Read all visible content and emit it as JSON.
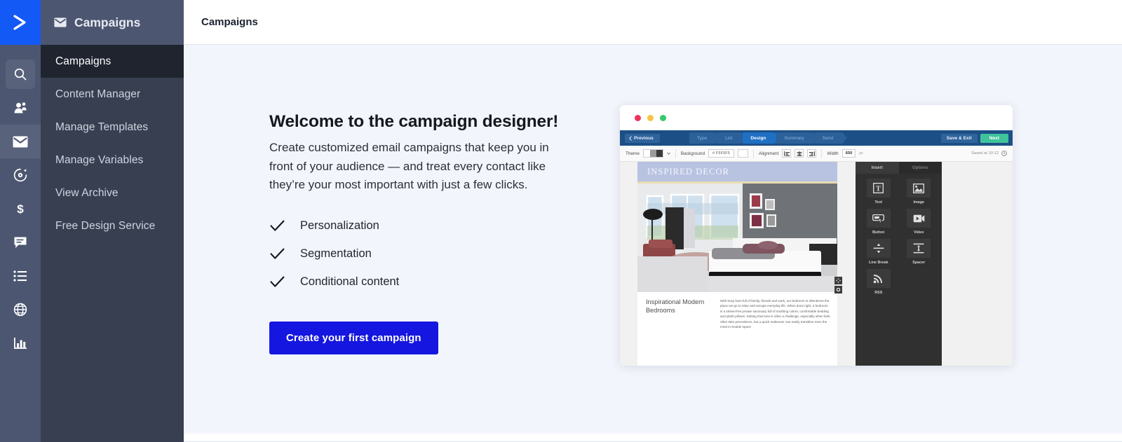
{
  "brand": {
    "logo_icon": "activecampaign-chevron-icon",
    "logo_color": "#1359f5"
  },
  "rail": {
    "items": [
      {
        "icon": "search-icon",
        "name": "search",
        "selected": true
      },
      {
        "icon": "contacts-people-icon",
        "name": "contacts",
        "selected": false
      },
      {
        "icon": "envelope-icon",
        "name": "campaigns",
        "selected": true
      },
      {
        "icon": "automations-gear-icon",
        "name": "automations",
        "selected": false
      },
      {
        "icon": "dollar-sign-icon",
        "name": "deals",
        "selected": false
      },
      {
        "icon": "chat-bubble-icon",
        "name": "conversations",
        "selected": false
      },
      {
        "icon": "list-icon",
        "name": "lists",
        "selected": false
      },
      {
        "icon": "globe-icon",
        "name": "website",
        "selected": false
      },
      {
        "icon": "bar-chart-icon",
        "name": "reports",
        "selected": false
      }
    ]
  },
  "subnav": {
    "header_icon": "envelope-icon",
    "header": "Campaigns",
    "items": [
      {
        "label": "Campaigns",
        "active": true
      },
      {
        "label": "Content Manager",
        "active": false
      },
      {
        "label": "Manage Templates",
        "active": false
      },
      {
        "label": "Manage Variables",
        "active": false
      },
      {
        "label": "View Archive",
        "active": false
      },
      {
        "label": "Free Design Service",
        "active": false
      }
    ]
  },
  "topbar": {
    "title": "Campaigns"
  },
  "hero": {
    "heading": "Welcome to the campaign designer!",
    "body": "Create customized email campaigns that keep you in front of your audience — and treat every contact like they’re your most important with just a few clicks.",
    "features": [
      {
        "icon": "check-icon",
        "label": "Personalization"
      },
      {
        "icon": "check-icon",
        "label": "Segmentation"
      },
      {
        "icon": "check-icon",
        "label": "Conditional content"
      }
    ],
    "cta_label": "Create your first campaign",
    "cta_color": "#1516e0"
  },
  "preview": {
    "window_dots": [
      "red",
      "yellow",
      "green"
    ],
    "nav": {
      "previous_label": "Previous",
      "steps": [
        {
          "label": "Type",
          "active": false
        },
        {
          "label": "List",
          "active": false
        },
        {
          "label": "Design",
          "active": true
        },
        {
          "label": "Summary",
          "active": false
        },
        {
          "label": "Send",
          "active": false
        }
      ],
      "save_exit_label": "Save & Exit",
      "next_label": "Next"
    },
    "toolbar": {
      "theme_label": "Theme",
      "background_label": "Background",
      "background_value": "# F5F5F5",
      "alignment_label": "Alignment",
      "width_label": "Width",
      "width_value": "650",
      "width_unit": "px",
      "saved_text": "Saved at 10:12",
      "clock_icon": "clock-icon"
    },
    "email": {
      "masthead": "INSPIRED DECOR",
      "headline": "Inspirational Modern Bedrooms",
      "body": "With busy lives full of family, friends and work, our bedroom is oftentimes the place we go to relax and escape everyday life. When done right, a bedroom is a stress-free private sanctuary full of soothing colors, comfortable bedding and plush pillows. Setting that tone is often a challenge, especially when kids often take precedence, but a quick makeover can easily transition even the most in-trouble space"
    },
    "panel": {
      "tabs": [
        {
          "label": "Insert",
          "active": true
        },
        {
          "label": "Options",
          "active": false
        }
      ],
      "blocks": [
        {
          "icon": "text-block-icon",
          "label": "Text"
        },
        {
          "icon": "image-block-icon",
          "label": "Image"
        },
        {
          "icon": "button-block-icon",
          "label": "Button"
        },
        {
          "icon": "video-block-icon",
          "label": "Video"
        },
        {
          "icon": "line-break-block-icon",
          "label": "Line Break"
        },
        {
          "icon": "spacer-block-icon",
          "label": "Spacer"
        },
        {
          "icon": "rss-block-icon",
          "label": "RSS"
        }
      ]
    }
  }
}
